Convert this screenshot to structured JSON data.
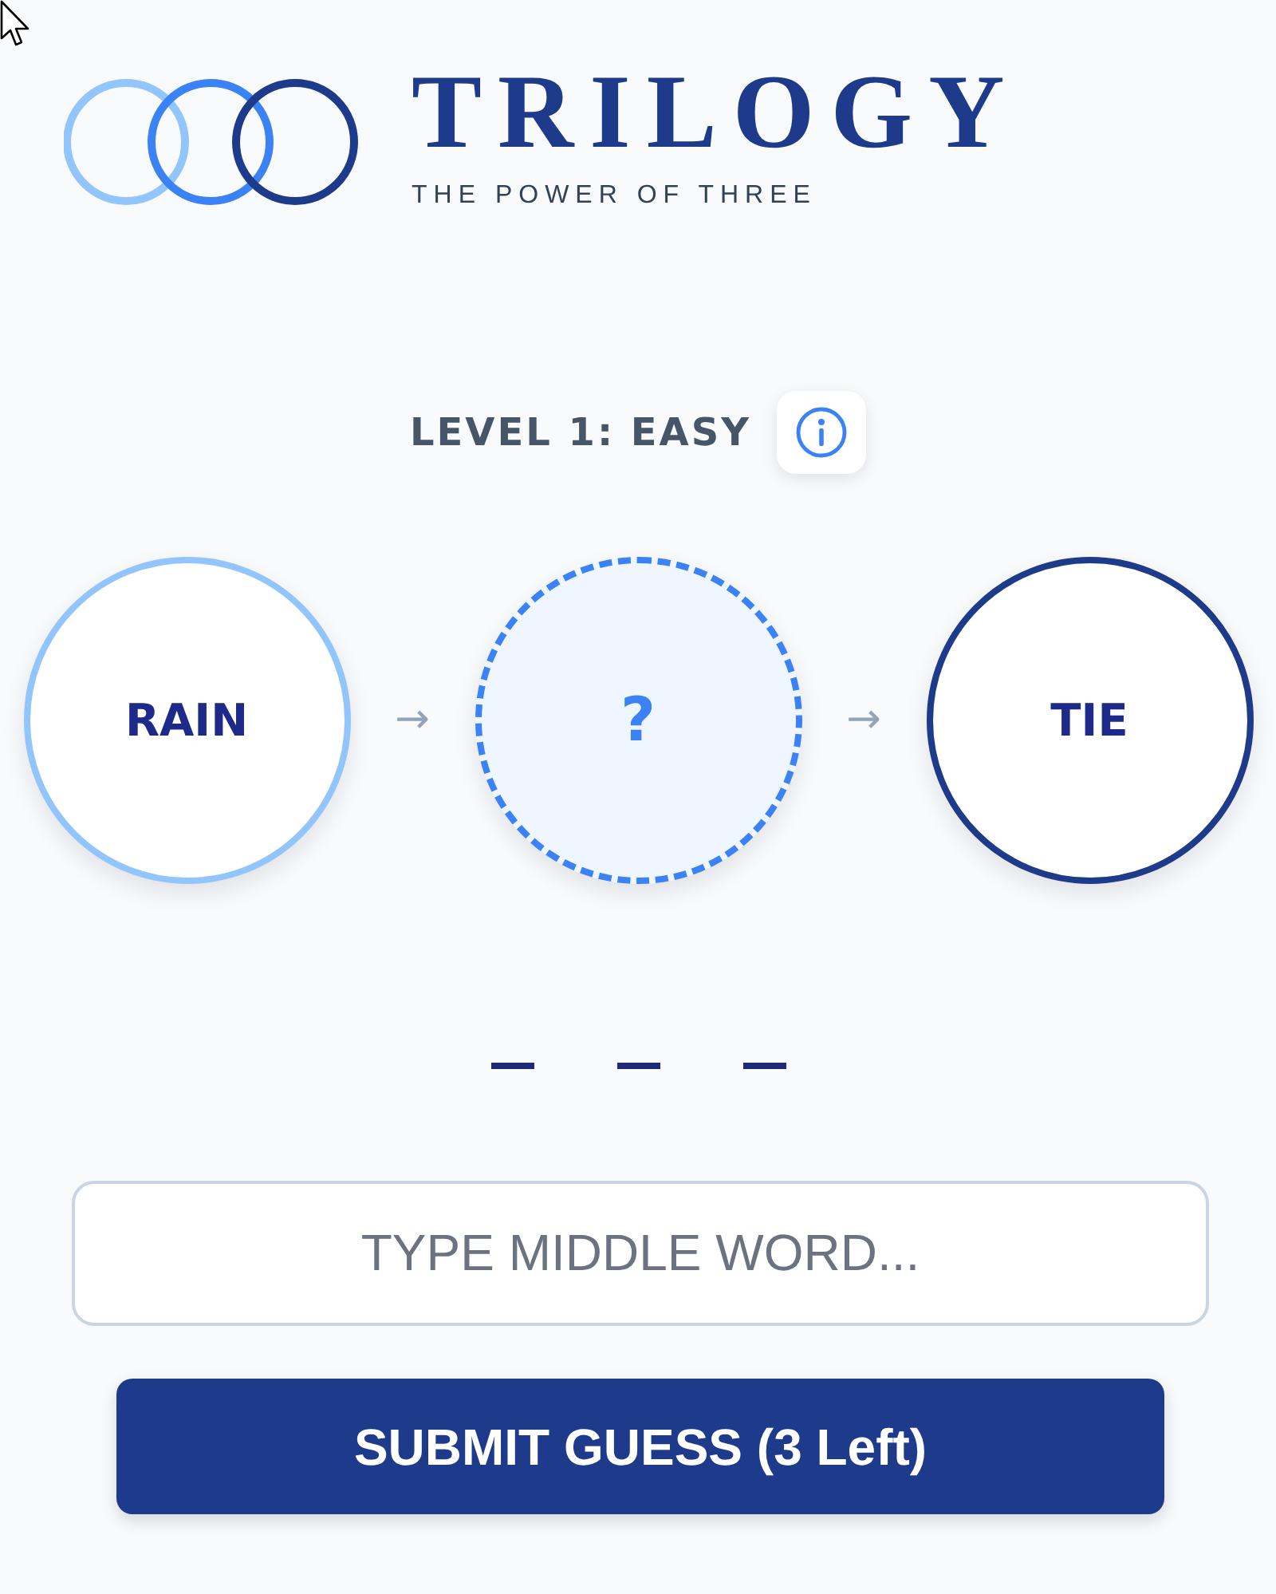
{
  "logo": {
    "rings": [
      {
        "color": "#93c5fd"
      },
      {
        "color": "#3b82f6"
      },
      {
        "color": "#1e3a8a"
      }
    ],
    "title": "TRILOGY",
    "subtitle": "THE POWER OF THREE"
  },
  "level": {
    "label": "LEVEL 1: EASY"
  },
  "chain": {
    "nodes": [
      {
        "kind": "word",
        "text": "RAIN",
        "color": "#93c5fd"
      },
      {
        "kind": "unknown",
        "text": "?",
        "color": "#3b82f6"
      },
      {
        "kind": "word",
        "text": "TIE",
        "color": "#1e3a8a"
      }
    ],
    "arrows": [
      "→",
      "→"
    ]
  },
  "letter_slots": [
    {
      "kind": "blank"
    },
    {
      "kind": "blank"
    },
    {
      "kind": "blank"
    }
  ],
  "guess_field": {
    "placeholder": "TYPE MIDDLE WORD..."
  },
  "submit_button": {
    "label": "SUBMIT GUESS (3 Left)"
  }
}
